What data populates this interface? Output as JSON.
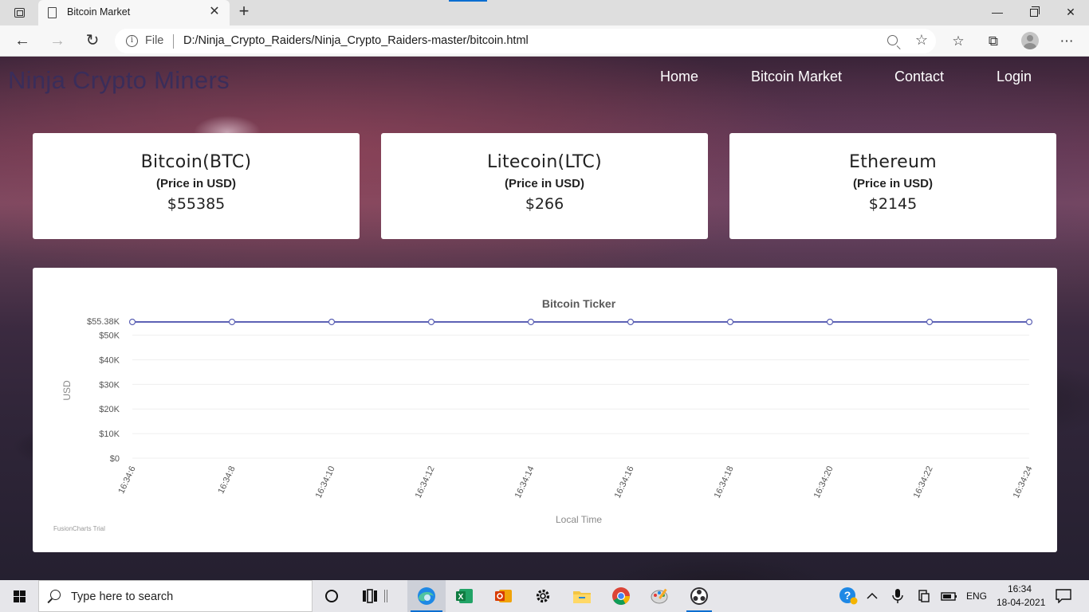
{
  "browser": {
    "tab_title": "Bitcoin Market",
    "address_scheme_label": "File",
    "url": "D:/Ninja_Crypto_Raiders/Ninja_Crypto_Raiders-master/bitcoin.html"
  },
  "site": {
    "brand": "Ninja Crypto Miners",
    "nav": [
      "Home",
      "Bitcoin Market",
      "Contact",
      "Login"
    ]
  },
  "cards": [
    {
      "name": "Bitcoin(BTC)",
      "unit": "(Price in USD)",
      "price": "$55385"
    },
    {
      "name": "Litecoin(LTC)",
      "unit": "(Price in USD)",
      "price": "$266"
    },
    {
      "name": "Ethereum",
      "unit": "(Price in USD)",
      "price": "$2145"
    }
  ],
  "chart_data": {
    "type": "line",
    "title": "Bitcoin Ticker",
    "xlabel": "Local Time",
    "ylabel": "USD",
    "x": [
      "16:34:6",
      "16:34:8",
      "16:34:10",
      "16:34:12",
      "16:34:14",
      "16:34:16",
      "16:34:18",
      "16:34:20",
      "16:34:22",
      "16:34:24"
    ],
    "series": [
      {
        "values": [
          55380,
          55380,
          55380,
          55380,
          55380,
          55380,
          55380,
          55380,
          55380,
          55380
        ]
      }
    ],
    "y_ticks": [
      0,
      10000,
      20000,
      30000,
      40000,
      50000
    ],
    "y_tick_labels": [
      "$0",
      "$10K",
      "$20K",
      "$30K",
      "$40K",
      "$50K"
    ],
    "ylim": [
      0,
      55380
    ],
    "max_label": "$55.38K",
    "watermark": "FusionCharts Trial",
    "colors": {
      "line": "#5d62b5"
    }
  },
  "taskbar": {
    "search_placeholder": "Type here to search",
    "language": "ENG",
    "time": "16:34",
    "date": "18-04-2021"
  }
}
